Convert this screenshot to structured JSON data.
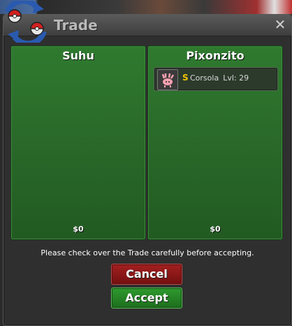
{
  "window": {
    "title": "Trade",
    "close_label": "✕"
  },
  "panels": [
    {
      "name": "Suhu",
      "money": "$0",
      "items": []
    },
    {
      "name": "Pixonzito",
      "money": "$0",
      "items": [
        {
          "badge": "S",
          "pokemon": "Corsola",
          "level": "Lvl: 29"
        }
      ]
    }
  ],
  "notice": "Please check over the Trade carefully before accepting.",
  "buttons": {
    "cancel": "Cancel",
    "accept": "Accept"
  },
  "colors": {
    "panel_green": "#2a6a2a",
    "cancel_red": "#a32020",
    "accept_green": "#2f9a2f",
    "badge_gold": "#f2c400"
  },
  "icons": {
    "logo": "pokeball-arrows-icon",
    "item": "corsola-icon"
  }
}
